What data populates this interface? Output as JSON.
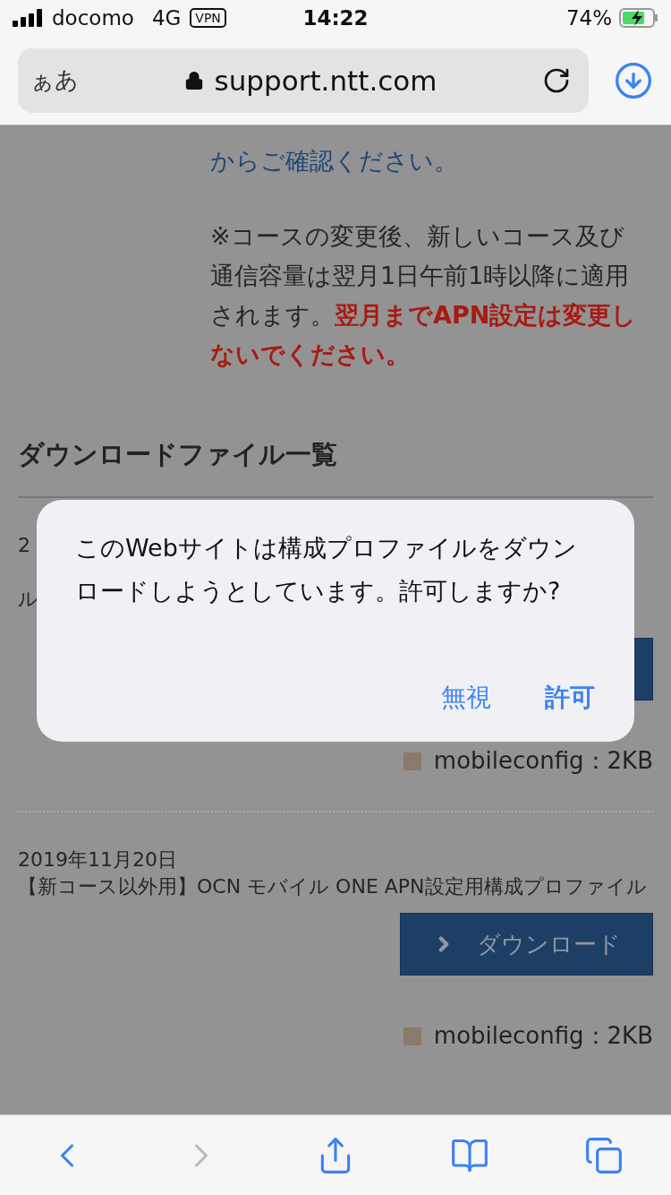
{
  "status_bar": {
    "carrier": "docomo",
    "network": "4G",
    "vpn": "VPN",
    "time": "14:22",
    "battery": "74%",
    "charging": true
  },
  "address_bar": {
    "reader": "ぁあ",
    "url": "support.ntt.com"
  },
  "content": {
    "link_text": "からご確認ください。",
    "note": "※コースの変更後、新しいコース及び通信容量は翌月1日午前1時以降に適用されます。**翌月までAPN設定は変更しないでください。**",
    "heading": "ダウンロードファイル一覧",
    "files": [
      {
        "date": "2",
        "title": "ル",
        "size": "mobileconfig：2KB"
      },
      {
        "date": "2019年11月20日",
        "title": "【新コース以外用】OCN モバイル ONE APN設定用構成プロファイル",
        "button": "ダウンロード",
        "size": "mobileconfig：2KB"
      }
    ]
  },
  "dialog": {
    "message": "このWebサイトは構成プロファイルをダウンロードしようとしています。許可しますか?",
    "buttons": [
      {
        "label": "無視",
        "primary": false
      },
      {
        "label": "許可",
        "primary": true
      }
    ]
  },
  "toolbar": [
    {
      "kind": "back",
      "disabled": false
    },
    {
      "kind": "forward",
      "disabled": true
    },
    {
      "kind": "share",
      "disabled": false
    },
    {
      "kind": "bookmarks",
      "disabled": false
    },
    {
      "kind": "tabs",
      "disabled": false
    }
  ]
}
